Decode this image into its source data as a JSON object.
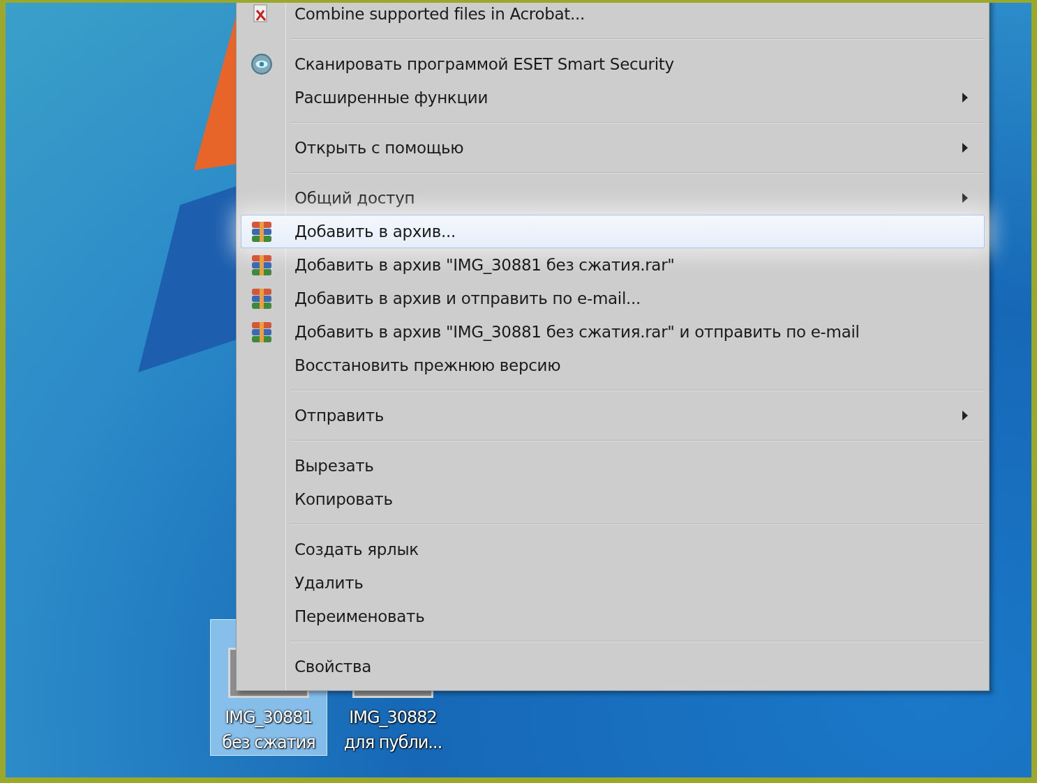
{
  "context_menu": {
    "items": [
      {
        "kind": "document",
        "label": "Combine supported files in Acrobat...",
        "submenu": false,
        "selected": false
      },
      {
        "kind": "separator"
      },
      {
        "kind": "scanner",
        "label": "Сканировать программой ESET Smart Security",
        "submenu": false,
        "selected": false
      },
      {
        "kind": "item",
        "label": "Расширенные функции",
        "submenu": true,
        "selected": false
      },
      {
        "kind": "separator"
      },
      {
        "kind": "item",
        "label": "Открыть с помощью",
        "submenu": true,
        "selected": false
      },
      {
        "kind": "separator"
      },
      {
        "kind": "item",
        "label": "Общий доступ",
        "submenu": true,
        "selected": false
      },
      {
        "kind": "archiver",
        "label": "Добавить в архив...",
        "submenu": false,
        "selected": true
      },
      {
        "kind": "archiver",
        "label": "Добавить в архив \"IMG_30881 без сжатия.rar\"",
        "submenu": false,
        "selected": false
      },
      {
        "kind": "archiver",
        "label": "Добавить в архив и отправить по e-mail...",
        "submenu": false,
        "selected": false
      },
      {
        "kind": "archiver",
        "label": "Добавить в архив \"IMG_30881 без сжатия.rar\" и отправить по e-mail",
        "submenu": false,
        "selected": false
      },
      {
        "kind": "item",
        "label": "Восстановить прежнюю версию",
        "submenu": false,
        "selected": false
      },
      {
        "kind": "separator"
      },
      {
        "kind": "item",
        "label": "Отправить",
        "submenu": true,
        "selected": false
      },
      {
        "kind": "separator"
      },
      {
        "kind": "item",
        "label": "Вырезать",
        "submenu": false,
        "selected": false
      },
      {
        "kind": "item",
        "label": "Копировать",
        "submenu": false,
        "selected": false
      },
      {
        "kind": "separator"
      },
      {
        "kind": "item",
        "label": "Создать ярлык",
        "submenu": false,
        "selected": false
      },
      {
        "kind": "item",
        "label": "Удалить",
        "submenu": false,
        "selected": false
      },
      {
        "kind": "item",
        "label": "Переименовать",
        "submenu": false,
        "selected": false
      },
      {
        "kind": "separator"
      },
      {
        "kind": "item",
        "label": "Свойства",
        "submenu": false,
        "selected": false
      }
    ]
  },
  "desktop_icons": [
    {
      "label": [
        "IMG_30881",
        "без сжатия"
      ],
      "selected": true
    },
    {
      "label": [
        "IMG_30882",
        "для публи..."
      ],
      "selected": false
    }
  ]
}
